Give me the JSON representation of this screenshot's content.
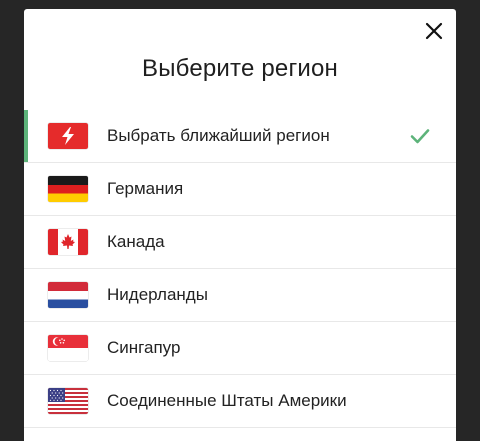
{
  "dialog": {
    "title": "Выберите регион",
    "close_icon": "close-icon"
  },
  "regions": [
    {
      "label": "Выбрать ближайший регион",
      "icon": "lightning-icon",
      "selected": true
    },
    {
      "label": "Германия",
      "icon": "flag-germany-icon",
      "selected": false
    },
    {
      "label": "Канада",
      "icon": "flag-canada-icon",
      "selected": false
    },
    {
      "label": "Нидерланды",
      "icon": "flag-netherlands-icon",
      "selected": false
    },
    {
      "label": "Сингапур",
      "icon": "flag-singapore-icon",
      "selected": false
    },
    {
      "label": "Соединенные Штаты Америки",
      "icon": "flag-usa-icon",
      "selected": false
    }
  ],
  "colors": {
    "accent": "#5db37a",
    "auto_icon_bg": "#e52b2b",
    "backdrop": "#262626"
  }
}
